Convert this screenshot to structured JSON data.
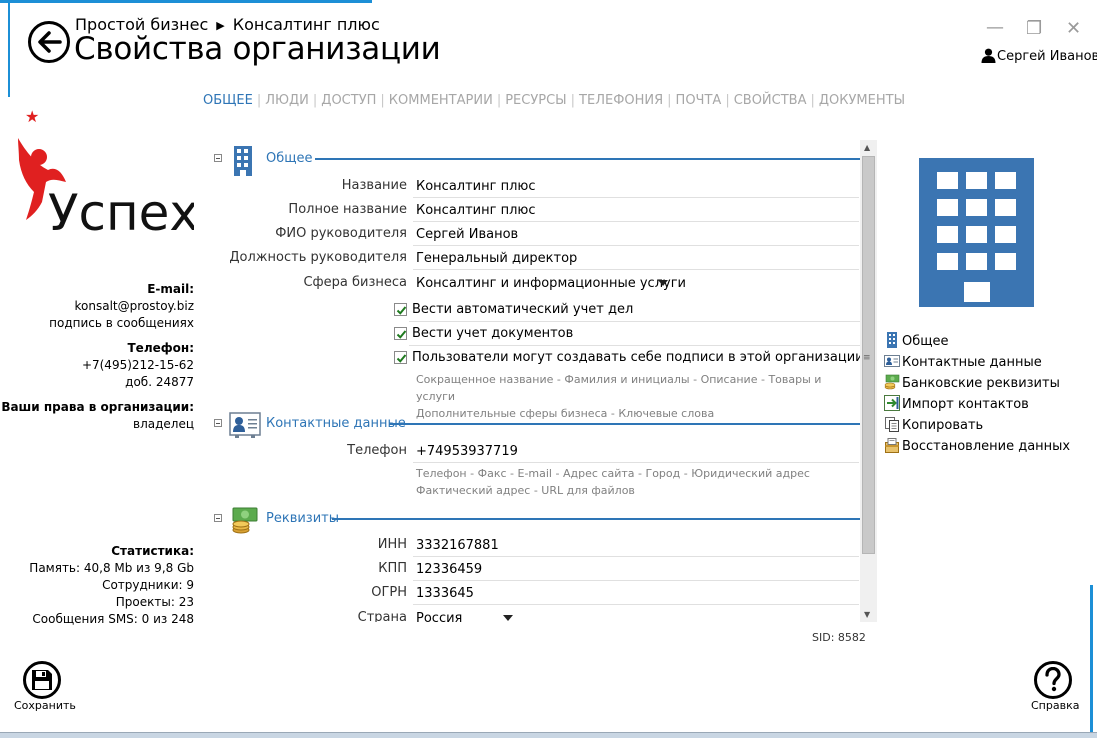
{
  "header": {
    "breadcrumb": [
      "Простой бизнес",
      "Консалтинг плюс"
    ],
    "breadcrumb_sep": "▶",
    "title": "Свойства организации",
    "user": "Сергей Иванов",
    "window_controls": {
      "minimize": "—",
      "restore": "❐",
      "close": "✕"
    }
  },
  "tabs": [
    "ОБЩЕЕ",
    "ЛЮДИ",
    "ДОСТУП",
    "КОММЕНТАРИИ",
    "РЕСУРСЫ",
    "ТЕЛЕФОНИЯ",
    "ПОЧТА",
    "СВОЙСТВА",
    "ДОКУМЕНТЫ"
  ],
  "tab_divider": "|",
  "logo": {
    "text": "Успех",
    "star": "★"
  },
  "sidebar": {
    "email_label": "E-mail:",
    "email": "konsalt@prostoy.biz",
    "email_note": "подпись в сообщениях",
    "phone_label": "Телефон:",
    "phone": "+7(495)212-15-62",
    "phone_ext": "доб. 24877",
    "rights_label": "Ваши права в организации:",
    "rights": "владелец",
    "stats_label": "Статистика:",
    "stats": [
      "Память: 40,8 Mb из 9,8 Gb",
      "Сотрудники: 9",
      "Проекты: 23",
      "Сообщения SMS: 0 из 248"
    ]
  },
  "form": {
    "general": {
      "title": "Общее",
      "fields": [
        {
          "label": "Название",
          "value": "Консалтинг плюс"
        },
        {
          "label": "Полное название",
          "value": "Консалтинг плюс"
        },
        {
          "label": "ФИО руководителя",
          "value": "Сергей Иванов"
        },
        {
          "label": "Должность руководителя",
          "value": "Гeнeральный директор"
        },
        {
          "label": "Сфера бизнеса",
          "value": "Консалтинг и информационные услуги"
        }
      ],
      "checkboxes": [
        {
          "label": "Вести автоматический учет дел",
          "checked": true
        },
        {
          "label": "Вести учет документов",
          "checked": true
        },
        {
          "label": "Пользователи могут создавать себе подписи в этой организации",
          "checked": true
        }
      ],
      "extra_links": [
        "Сокращенное название",
        "Фамилия и инициалы",
        "Описание",
        "Товары и услуги",
        "Дополнительные сферы бизнеса",
        "Ключевые слова"
      ]
    },
    "contacts": {
      "title": "Контактные данные",
      "fields": [
        {
          "label": "Телефон",
          "value": "+74953937719"
        }
      ],
      "extra_links": [
        "Телефон",
        "Факс",
        "E-mail",
        "Адрес сайта",
        "Город",
        "Юридический адрес",
        "Фактический адрес",
        "URL для файлов"
      ]
    },
    "requisites": {
      "title": "Реквизиты",
      "fields": [
        {
          "label": "ИНН",
          "value": "3332167881"
        },
        {
          "label": "КПП",
          "value": "12336459"
        },
        {
          "label": "ОГРН",
          "value": "1333645"
        },
        {
          "label": "Страна",
          "value": "Россия"
        }
      ]
    },
    "link_sep": "-"
  },
  "actions": [
    {
      "label": "Общее",
      "icon": "building-icon"
    },
    {
      "label": "Контактные данные",
      "icon": "contact-card-icon"
    },
    {
      "label": "Банковские реквизиты",
      "icon": "money-icon"
    },
    {
      "label": "Импорт контактов",
      "icon": "import-icon"
    },
    {
      "label": "Копировать",
      "icon": "copy-icon"
    },
    {
      "label": "Восстановление данных",
      "icon": "restore-icon"
    }
  ],
  "sid": "SID: 8582",
  "footer": {
    "save_label": "Сохранить",
    "help_label": "Справка"
  },
  "colors": {
    "accent": "#2e75b6",
    "window_border": "#1c8fd6",
    "building": "#3b75b2",
    "logo_red": "#e02020"
  }
}
